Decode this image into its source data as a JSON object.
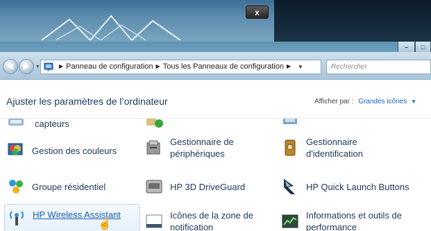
{
  "background_window": {
    "close_label": "x"
  },
  "window_controls": {
    "minimize": "–",
    "maximize": "□"
  },
  "navigation": {
    "breadcrumbs": [
      "Panneau de configuration",
      "Tous les Panneaux de configuration"
    ],
    "search_placeholder": "Rechercher"
  },
  "header": {
    "title": "Ajuster les paramètres de l’ordinateur",
    "view_label": "Afficher par :",
    "view_value": "Grandes icônes"
  },
  "items": [
    {
      "id": "capteurs",
      "label": "capteurs",
      "icon": "sensor-icon"
    },
    {
      "id": "couleurs",
      "label": "Gestion des couleurs",
      "icon": "color-management-icon"
    },
    {
      "id": "peripheriques",
      "label": "Gestionnaire de périphériques",
      "line1": "Gestionnaire de",
      "line2": "périphériques",
      "icon": "device-manager-icon"
    },
    {
      "id": "identification",
      "label": "Gestionnaire d'identification",
      "line1": "Gestionnaire",
      "line2": "d'identification",
      "icon": "credential-manager-icon"
    },
    {
      "id": "groupe",
      "label": "Groupe résidentiel",
      "icon": "homegroup-icon"
    },
    {
      "id": "driveguard",
      "label": "HP 3D DriveGuard",
      "icon": "drive-guard-icon"
    },
    {
      "id": "quicklaunch",
      "label": "HP Quick Launch Buttons",
      "icon": "quick-launch-icon"
    },
    {
      "id": "wireless",
      "label": "HP Wireless Assistant",
      "icon": "wireless-icon"
    },
    {
      "id": "notification",
      "label": "Icônes de la zone de notification",
      "line1": "Icônes de la zone de",
      "line2": "notification",
      "icon": "notification-area-icon"
    },
    {
      "id": "performance",
      "label": "Informations et outils de performance",
      "line1": "Informations et outils de",
      "line2": "performance",
      "icon": "performance-icon"
    }
  ],
  "colors": {
    "link_text": "#1e395b",
    "hover_link": "#1a5fb4",
    "accent_blue": "#1d5fbb"
  }
}
